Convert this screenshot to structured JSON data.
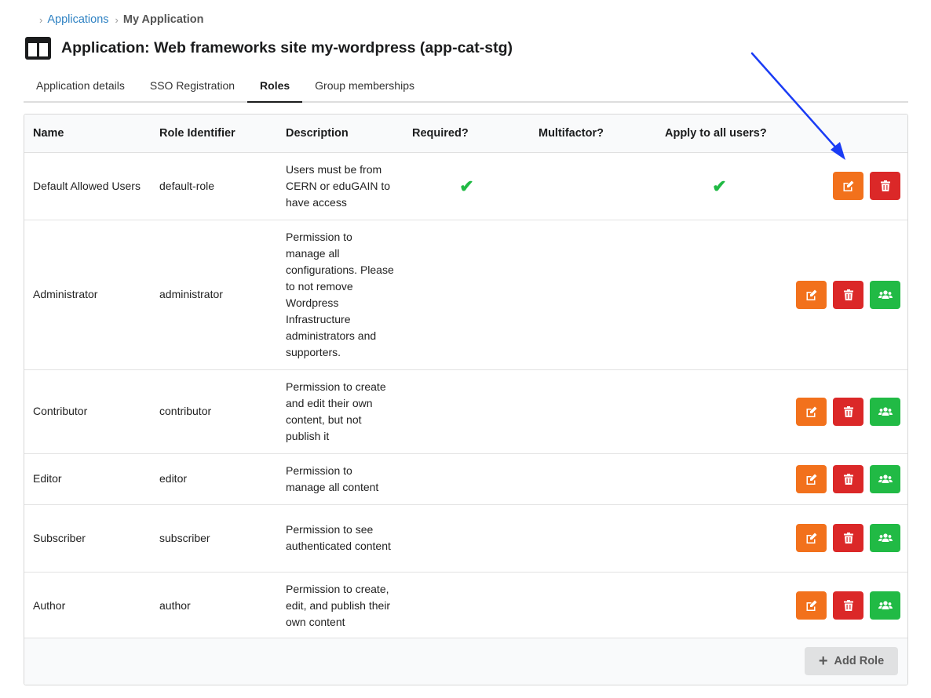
{
  "breadcrumb": {
    "sep": "›",
    "link": "Applications",
    "current": "My Application"
  },
  "page_title": "Application: Web frameworks site my-wordpress (app-cat-stg)",
  "tabs": [
    {
      "label": "Application details",
      "active": false
    },
    {
      "label": "SSO Registration",
      "active": false
    },
    {
      "label": "Roles",
      "active": true
    },
    {
      "label": "Group memberships",
      "active": false
    }
  ],
  "table": {
    "headers": [
      "Name",
      "Role Identifier",
      "Description",
      "Required?",
      "Multifactor?",
      "Apply to all users?"
    ],
    "rows": [
      {
        "name": "Default Allowed Users",
        "identifier": "default-role",
        "description": "Users must be from CERN or eduGAIN to have access",
        "required": "✔",
        "multifactor": "",
        "apply_all": "✔"
      },
      {
        "name": "Administrator",
        "identifier": "administrator",
        "description": "Permission to manage all configurations. Please to not remove Wordpress Infrastructure administrators and supporters.",
        "required": "",
        "multifactor": "",
        "apply_all": ""
      },
      {
        "name": "Contributor",
        "identifier": "contributor",
        "description": "Permission to create and edit their own content, but not publish it",
        "required": "",
        "multifactor": "",
        "apply_all": ""
      },
      {
        "name": "Editor",
        "identifier": "editor",
        "description": "Permission to manage all content",
        "required": "",
        "multifactor": "",
        "apply_all": ""
      },
      {
        "name": "Subscriber",
        "identifier": "subscriber",
        "description": "Permission to see authenticated content",
        "required": "",
        "multifactor": "",
        "apply_all": ""
      },
      {
        "name": "Author",
        "identifier": "author",
        "description": "Permission to create, edit, and publish their own content",
        "required": "",
        "multifactor": "",
        "apply_all": ""
      }
    ]
  },
  "footer": {
    "add_role_icon": "+",
    "add_role_label": "Add Role"
  },
  "colors": {
    "edit": "#f2711c",
    "delete": "#db2828",
    "members": "#21ba45",
    "check": "#21ba45",
    "link": "#2f82c3",
    "annotation_arrow": "#1a3cf5"
  },
  "icons": {
    "app": "columns-icon",
    "edit": "edit-icon",
    "delete": "trash-icon",
    "members": "users-icon",
    "check": "checkmark-icon"
  }
}
